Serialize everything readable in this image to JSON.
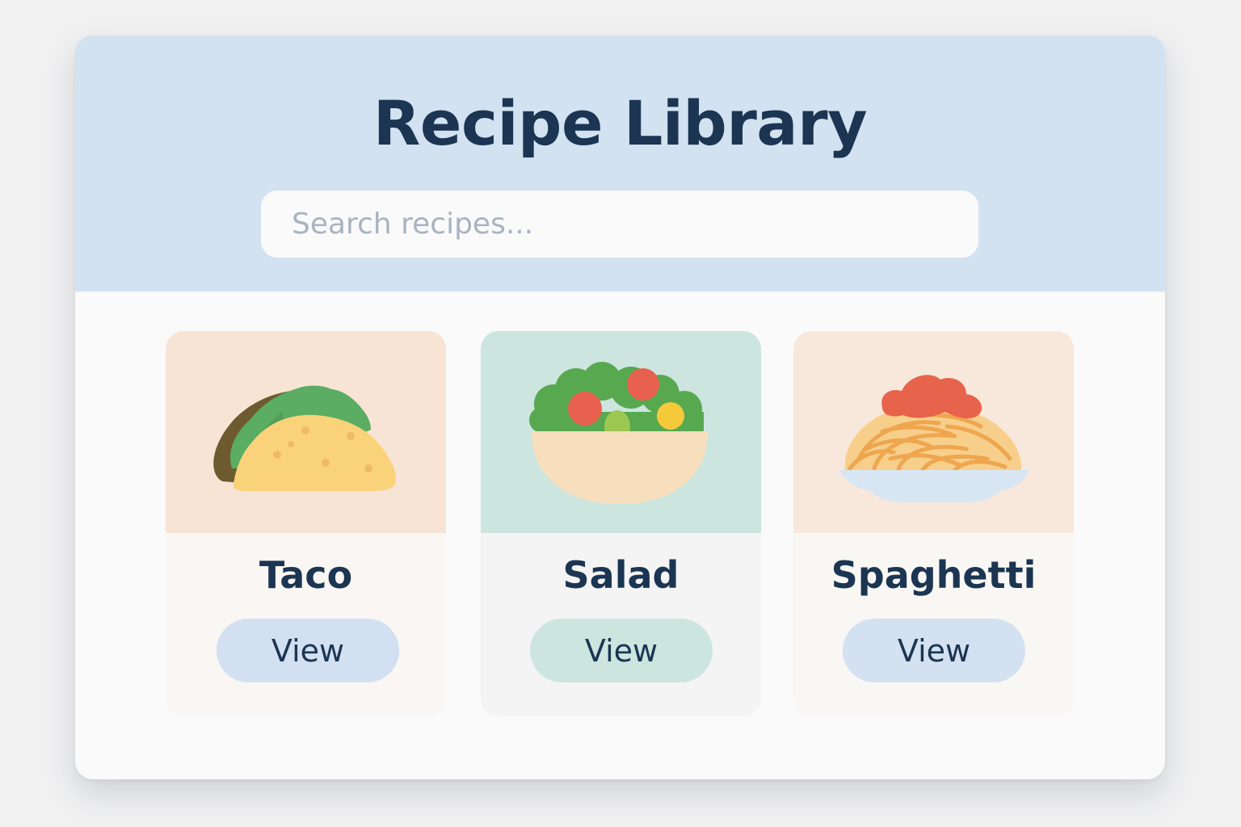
{
  "header": {
    "title": "Recipe Library"
  },
  "search": {
    "placeholder": "Search recipes...",
    "value": ""
  },
  "recipes": [
    {
      "name": "Taco",
      "button_label": "View",
      "icon": "taco-icon",
      "image_bg": "#f7e4d5",
      "card_bg": "#f9f6f3",
      "button_bg": "#d2e0f1"
    },
    {
      "name": "Salad",
      "button_label": "View",
      "icon": "salad-icon",
      "image_bg": "#cce5df",
      "card_bg": "#f4f4f4",
      "button_bg": "#cde5df"
    },
    {
      "name": "Spaghetti",
      "button_label": "View",
      "icon": "spaghetti-icon",
      "image_bg": "#f8e8db",
      "card_bg": "#f9f7f4",
      "button_bg": "#d3e1f1"
    }
  ],
  "colors": {
    "header_bg": "#d3e2f1",
    "title_text": "#1b3552",
    "page_bg": "#f1f1f2",
    "window_bg": "#fafafa"
  }
}
